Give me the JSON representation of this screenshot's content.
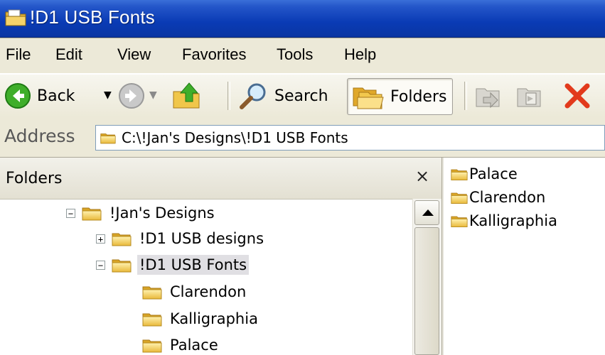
{
  "window": {
    "title": "!D1 USB Fonts",
    "accent": "#0a3bb5"
  },
  "menu": {
    "items": [
      {
        "label": "File"
      },
      {
        "label": "Edit"
      },
      {
        "label": "View"
      },
      {
        "label": "Favorites"
      },
      {
        "label": "Tools"
      },
      {
        "label": "Help"
      }
    ]
  },
  "toolbar": {
    "back_label": "Back",
    "search_label": "Search",
    "folders_label": "Folders",
    "icons": [
      "back-arrow-icon",
      "forward-arrow-icon",
      "up-folder-icon",
      "search-icon",
      "folders-icon",
      "move-to-icon",
      "copy-to-icon",
      "delete-icon"
    ]
  },
  "address": {
    "label": "Address",
    "value": "C:\\!Jan's Designs\\!D1 USB Fonts"
  },
  "folders_pane": {
    "title": "Folders",
    "close_glyph": "×",
    "tree": [
      {
        "label": "!Jan's Designs",
        "expander": "−"
      },
      {
        "label": "!D1 USB designs",
        "expander": "+"
      },
      {
        "label": "!D1 USB Fonts",
        "expander": "−",
        "selected": true
      },
      {
        "label": "Clarendon"
      },
      {
        "label": "Kalligraphia"
      },
      {
        "label": "Palace"
      }
    ]
  },
  "contents": {
    "items": [
      {
        "label": "Palace"
      },
      {
        "label": "Clarendon"
      },
      {
        "label": "Kalligraphia"
      }
    ]
  }
}
